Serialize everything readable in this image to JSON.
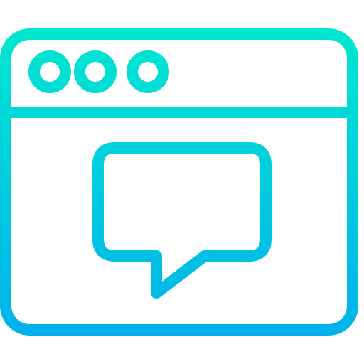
{
  "icon": {
    "name": "browser-window-chat-icon",
    "parts": [
      "window-frame-icon",
      "title-bar-icon",
      "window-dot-icon",
      "speech-bubble-icon"
    ],
    "gradient": {
      "top": "#00E7D0",
      "bottom": "#00B2EC"
    }
  }
}
